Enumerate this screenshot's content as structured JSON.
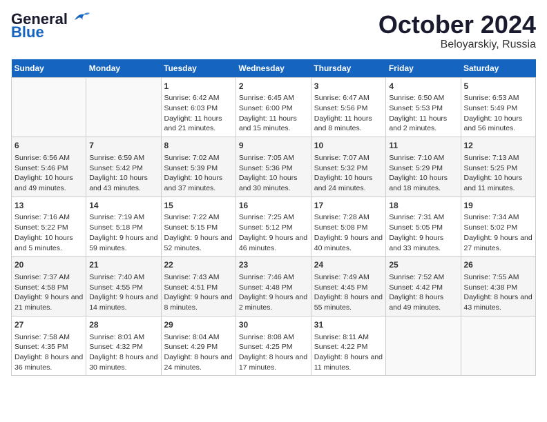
{
  "header": {
    "logo_line1": "General",
    "logo_line2": "Blue",
    "month_year": "October 2024",
    "location": "Beloyarskiy, Russia"
  },
  "days_of_week": [
    "Sunday",
    "Monday",
    "Tuesday",
    "Wednesday",
    "Thursday",
    "Friday",
    "Saturday"
  ],
  "weeks": [
    [
      {
        "day": "",
        "empty": true
      },
      {
        "day": "",
        "empty": true
      },
      {
        "day": "1",
        "sunrise": "6:42 AM",
        "sunset": "6:03 PM",
        "daylight": "11 hours and 21 minutes."
      },
      {
        "day": "2",
        "sunrise": "6:45 AM",
        "sunset": "6:00 PM",
        "daylight": "11 hours and 15 minutes."
      },
      {
        "day": "3",
        "sunrise": "6:47 AM",
        "sunset": "5:56 PM",
        "daylight": "11 hours and 8 minutes."
      },
      {
        "day": "4",
        "sunrise": "6:50 AM",
        "sunset": "5:53 PM",
        "daylight": "11 hours and 2 minutes."
      },
      {
        "day": "5",
        "sunrise": "6:53 AM",
        "sunset": "5:49 PM",
        "daylight": "10 hours and 56 minutes."
      }
    ],
    [
      {
        "day": "6",
        "sunrise": "6:56 AM",
        "sunset": "5:46 PM",
        "daylight": "10 hours and 49 minutes."
      },
      {
        "day": "7",
        "sunrise": "6:59 AM",
        "sunset": "5:42 PM",
        "daylight": "10 hours and 43 minutes."
      },
      {
        "day": "8",
        "sunrise": "7:02 AM",
        "sunset": "5:39 PM",
        "daylight": "10 hours and 37 minutes."
      },
      {
        "day": "9",
        "sunrise": "7:05 AM",
        "sunset": "5:36 PM",
        "daylight": "10 hours and 30 minutes."
      },
      {
        "day": "10",
        "sunrise": "7:07 AM",
        "sunset": "5:32 PM",
        "daylight": "10 hours and 24 minutes."
      },
      {
        "day": "11",
        "sunrise": "7:10 AM",
        "sunset": "5:29 PM",
        "daylight": "10 hours and 18 minutes."
      },
      {
        "day": "12",
        "sunrise": "7:13 AM",
        "sunset": "5:25 PM",
        "daylight": "10 hours and 11 minutes."
      }
    ],
    [
      {
        "day": "13",
        "sunrise": "7:16 AM",
        "sunset": "5:22 PM",
        "daylight": "10 hours and 5 minutes."
      },
      {
        "day": "14",
        "sunrise": "7:19 AM",
        "sunset": "5:18 PM",
        "daylight": "9 hours and 59 minutes."
      },
      {
        "day": "15",
        "sunrise": "7:22 AM",
        "sunset": "5:15 PM",
        "daylight": "9 hours and 52 minutes."
      },
      {
        "day": "16",
        "sunrise": "7:25 AM",
        "sunset": "5:12 PM",
        "daylight": "9 hours and 46 minutes."
      },
      {
        "day": "17",
        "sunrise": "7:28 AM",
        "sunset": "5:08 PM",
        "daylight": "9 hours and 40 minutes."
      },
      {
        "day": "18",
        "sunrise": "7:31 AM",
        "sunset": "5:05 PM",
        "daylight": "9 hours and 33 minutes."
      },
      {
        "day": "19",
        "sunrise": "7:34 AM",
        "sunset": "5:02 PM",
        "daylight": "9 hours and 27 minutes."
      }
    ],
    [
      {
        "day": "20",
        "sunrise": "7:37 AM",
        "sunset": "4:58 PM",
        "daylight": "9 hours and 21 minutes."
      },
      {
        "day": "21",
        "sunrise": "7:40 AM",
        "sunset": "4:55 PM",
        "daylight": "9 hours and 14 minutes."
      },
      {
        "day": "22",
        "sunrise": "7:43 AM",
        "sunset": "4:51 PM",
        "daylight": "9 hours and 8 minutes."
      },
      {
        "day": "23",
        "sunrise": "7:46 AM",
        "sunset": "4:48 PM",
        "daylight": "9 hours and 2 minutes."
      },
      {
        "day": "24",
        "sunrise": "7:49 AM",
        "sunset": "4:45 PM",
        "daylight": "8 hours and 55 minutes."
      },
      {
        "day": "25",
        "sunrise": "7:52 AM",
        "sunset": "4:42 PM",
        "daylight": "8 hours and 49 minutes."
      },
      {
        "day": "26",
        "sunrise": "7:55 AM",
        "sunset": "4:38 PM",
        "daylight": "8 hours and 43 minutes."
      }
    ],
    [
      {
        "day": "27",
        "sunrise": "7:58 AM",
        "sunset": "4:35 PM",
        "daylight": "8 hours and 36 minutes."
      },
      {
        "day": "28",
        "sunrise": "8:01 AM",
        "sunset": "4:32 PM",
        "daylight": "8 hours and 30 minutes."
      },
      {
        "day": "29",
        "sunrise": "8:04 AM",
        "sunset": "4:29 PM",
        "daylight": "8 hours and 24 minutes."
      },
      {
        "day": "30",
        "sunrise": "8:08 AM",
        "sunset": "4:25 PM",
        "daylight": "8 hours and 17 minutes."
      },
      {
        "day": "31",
        "sunrise": "8:11 AM",
        "sunset": "4:22 PM",
        "daylight": "8 hours and 11 minutes."
      },
      {
        "day": "",
        "empty": true
      },
      {
        "day": "",
        "empty": true
      }
    ]
  ]
}
